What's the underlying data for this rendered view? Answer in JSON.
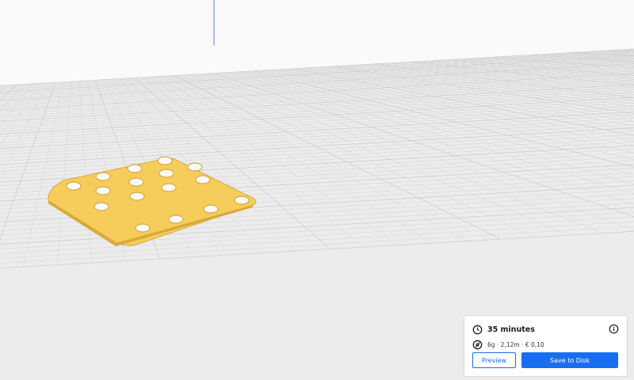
{
  "viewport": {
    "model": "perforated-plate",
    "colors": {
      "build_plate": "#ececec",
      "grid_line": "#c9c9c9",
      "axis_z": "#3d82ee",
      "model_top": "#f6cd5b",
      "model_edge": "#d9a83a"
    }
  },
  "print_info": {
    "time_icon": "clock-icon",
    "time_label": "35 minutes",
    "info_icon": "info-icon",
    "material_icon": "spool-icon",
    "material_label": "6g · 2,12m · € 0,10"
  },
  "actions": {
    "preview_label": "Preview",
    "save_label": "Save to Disk",
    "accent_color": "#196ef0"
  }
}
